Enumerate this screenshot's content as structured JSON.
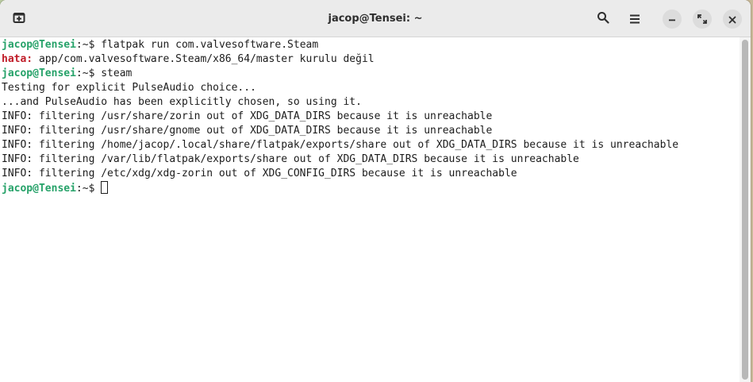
{
  "window": {
    "title": "jacop@Tensei: ~",
    "buttons": {
      "new_tab": "new-tab-icon",
      "search": "search-icon",
      "menu": "hamburger-menu-icon",
      "minimize": "minimize-icon",
      "maximize": "maximize-icon",
      "close": "close-icon"
    }
  },
  "terminal": {
    "lines": [
      {
        "prompt_user": "jacop@Tensei",
        "prompt_path": ":~$ ",
        "command": "flatpak run com.valvesoftware.Steam"
      },
      {
        "error_label": "hata:",
        "text": " app/com.valvesoftware.Steam/x86_64/master kurulu değil"
      },
      {
        "prompt_user": "jacop@Tensei",
        "prompt_path": ":~$ ",
        "command": "steam"
      },
      {
        "text": "Testing for explicit PulseAudio choice..."
      },
      {
        "text": "...and PulseAudio has been explicitly chosen, so using it."
      },
      {
        "text": "INFO: filtering /usr/share/zorin out of XDG_DATA_DIRS because it is unreachable"
      },
      {
        "text": "INFO: filtering /usr/share/gnome out of XDG_DATA_DIRS because it is unreachable"
      },
      {
        "text": "INFO: filtering /home/jacop/.local/share/flatpak/exports/share out of XDG_DATA_DIRS because it is unreachable"
      },
      {
        "text": "INFO: filtering /var/lib/flatpak/exports/share out of XDG_DATA_DIRS because it is unreachable"
      },
      {
        "text": "INFO: filtering /etc/xdg/xdg-zorin out of XDG_CONFIG_DIRS because it is unreachable"
      },
      {
        "prompt_user": "jacop@Tensei",
        "prompt_path": ":~$ ",
        "command": ""
      }
    ]
  },
  "colors": {
    "prompt_user": "#26a269",
    "error": "#c01c28",
    "text": "#1c1c1c",
    "headerbar": "#ebebeb"
  }
}
